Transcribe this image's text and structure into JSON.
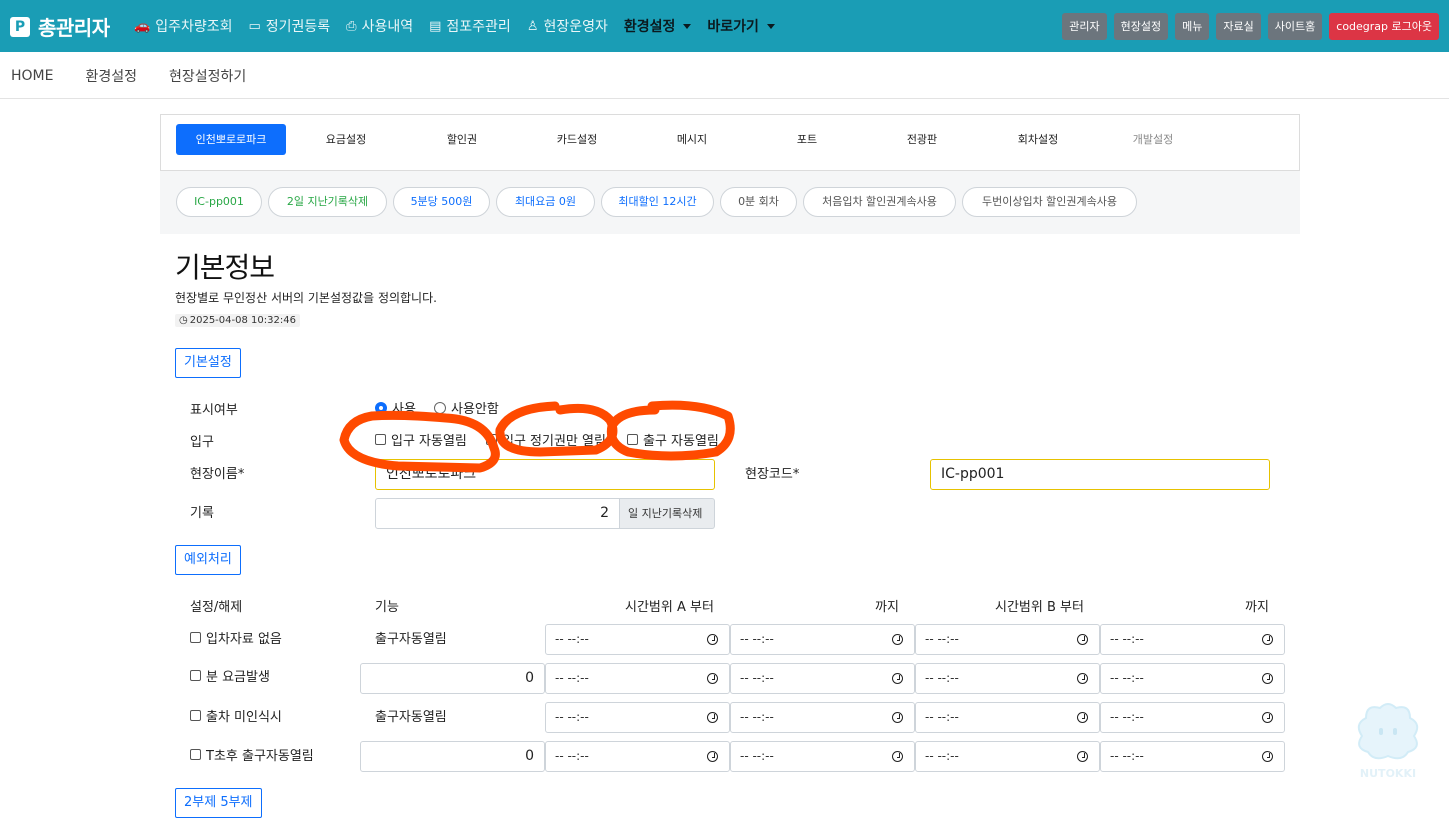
{
  "brand": {
    "logo_letter": "P",
    "title": "총관리자"
  },
  "topnav": [
    {
      "label": "입주차량조회",
      "icon": "car-icon"
    },
    {
      "label": "정기권등록",
      "icon": "id-card-icon"
    },
    {
      "label": "사용내역",
      "icon": "print-icon"
    },
    {
      "label": "점포주관리",
      "icon": "store-icon"
    },
    {
      "label": "현장운영자",
      "icon": "user-shield-icon"
    },
    {
      "label": "환경설정",
      "dropdown": true
    },
    {
      "label": "바로가기",
      "dropdown": true
    }
  ],
  "top_buttons": [
    "관리자",
    "현장설정",
    "메뉴",
    "자료실",
    "사이트홈",
    "codegrap 로그아웃"
  ],
  "breadcrumb": [
    "HOME",
    "환경설정",
    "현장설정하기"
  ],
  "tabs": [
    {
      "label": "인천뽀로로파크",
      "active": true
    },
    {
      "label": "요금설정"
    },
    {
      "label": "할인권"
    },
    {
      "label": "카드설정"
    },
    {
      "label": "메시지"
    },
    {
      "label": "포트"
    },
    {
      "label": "전광판"
    },
    {
      "label": "회차설정"
    },
    {
      "label": "개발설정",
      "muted": true
    }
  ],
  "chips": [
    {
      "label": "IC-pp001",
      "color": "green"
    },
    {
      "label": "2일 지난기록삭제",
      "color": "green"
    },
    {
      "label": "5분당 500원",
      "color": "blue"
    },
    {
      "label": "최대요금 0원",
      "color": "blue"
    },
    {
      "label": "최대할인 12시간",
      "color": "blue"
    },
    {
      "label": "0분 회차",
      "color": "gray"
    },
    {
      "label": "처음입차 할인권계속사용",
      "color": "gray"
    },
    {
      "label": "두번이상입차 할인권계속사용",
      "color": "gray"
    }
  ],
  "page": {
    "title": "기본정보",
    "description": "현장별로 무인정산 서버의 기본설정값을 정의합니다.",
    "timestamp": "2025-04-08 10:32:46"
  },
  "basic": {
    "section_label": "기본설정",
    "display_label": "표시여부",
    "radio_use": "사용",
    "radio_nouse": "사용안함",
    "selected": "사용",
    "entry_label": "입구",
    "checks": [
      "입구 자동열림",
      "입구 정기권만 열림",
      "출구 자동열림"
    ],
    "site_name_label": "현장이름*",
    "site_name_value": "인천뽀로로파크",
    "site_code_label": "현장코드*",
    "site_code_value": "IC-pp001",
    "record_label": "기록",
    "record_value": "2",
    "record_suffix": "일 지난기록삭제"
  },
  "exceptions": {
    "section_label": "예외처리",
    "headers": [
      "설정/해제",
      "기능",
      "시간범위 A 부터",
      "까지",
      "시간범위 B 부터",
      "까지"
    ],
    "rows": [
      {
        "label": "입차자료 없음",
        "function": "출구자동열림"
      },
      {
        "label": "분 요금발생",
        "input": "0"
      },
      {
        "label": "출차 미인식시",
        "function": "출구자동열림"
      },
      {
        "label": "T초후 출구자동열림",
        "input": "0"
      }
    ],
    "time_placeholder": "-- --:--"
  },
  "next_section": {
    "section_label": "2부제 5부제"
  },
  "colors": {
    "topbar": "#1a9db5",
    "primary": "#0d6efd",
    "logout": "#dc3545",
    "annotation": "#ff4a00"
  }
}
